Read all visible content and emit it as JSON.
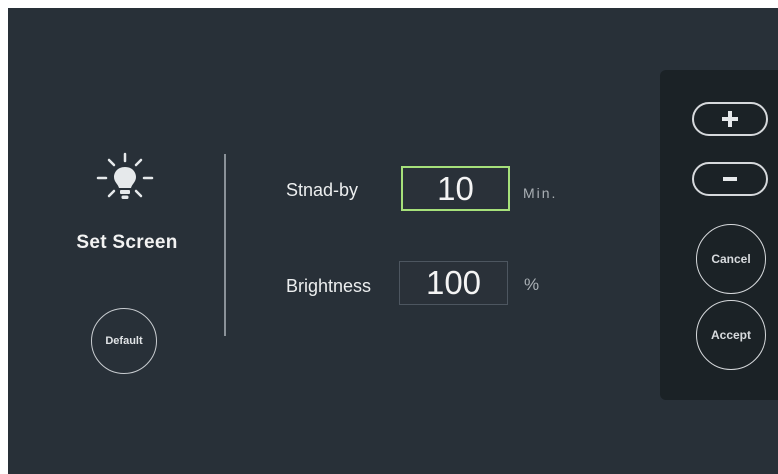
{
  "screen": {
    "title": "Set Screen",
    "icon": "lightbulb-icon",
    "default_label": "Default"
  },
  "fields": {
    "standby": {
      "label": "Stnad-by",
      "value": "10",
      "unit": "Min."
    },
    "brightness": {
      "label": "Brightness",
      "value": "100",
      "unit": "%"
    }
  },
  "side_panel": {
    "plus_icon": "plus-icon",
    "minus_icon": "minus-icon",
    "cancel_label": "Cancel",
    "accept_label": "Accept"
  },
  "colors": {
    "background": "#283038",
    "panel": "#1b2226",
    "active_field_border": "#a6e07a"
  }
}
